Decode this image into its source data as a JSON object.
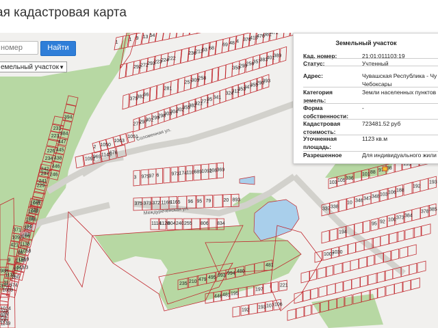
{
  "header": {
    "title": "ая кадастровая карта"
  },
  "search": {
    "placeholder": "номер",
    "button_label": "Найти"
  },
  "filter": {
    "selected": "емельный участок"
  },
  "info_panel": {
    "title": "Земельный участок",
    "rows": [
      {
        "label": "Кад. номер:",
        "value": "21:01:011103:19"
      },
      {
        "label": "Статус:",
        "value": "Учтенный"
      },
      {
        "label": "Адрес:",
        "value": "Чувашская Республика - Чу"
      },
      {
        "label": "",
        "value": "Чебоксары"
      },
      {
        "label": "Категория",
        "value": "Земли населенных пунктов"
      },
      {
        "label": "земель:",
        "value": ""
      },
      {
        "label": "Форма",
        "value": "-"
      },
      {
        "label": "собственности:",
        "value": ""
      },
      {
        "label": "Кадастровая",
        "value": "723481.52 руб"
      },
      {
        "label": "стоимость:",
        "value": ""
      },
      {
        "label": "Уточненная",
        "value": "1123 кв.м"
      },
      {
        "label": "площадь:",
        "value": ""
      },
      {
        "label": "Разрешенное",
        "value": "Для индивидуального жили"
      }
    ]
  },
  "map": {
    "colors": {
      "parcel": "#c1272d",
      "forest": "#b7d8a3",
      "water": "#a9cfeb",
      "background": "#f1f0ee",
      "building": "#bdbdbd"
    },
    "streets": [
      "Соломенная ул.",
      "Междуреченская ул."
    ],
    "labels": [
      "1",
      "1",
      "9",
      "13",
      "54",
      "122",
      "55",
      "101",
      "278",
      "319",
      "307",
      "318",
      "279",
      "265",
      "296",
      "300",
      "289",
      "275",
      "292",
      "272",
      "293",
      "223",
      "224",
      "222",
      "236",
      "213",
      "63",
      "68",
      "69",
      "48",
      "4",
      "376",
      "415",
      "476",
      "381",
      "472",
      "370",
      "373",
      "364",
      "375",
      "382",
      "66",
      "281",
      "257",
      "305",
      "258",
      "350",
      "295",
      "256",
      "357",
      "383",
      "401",
      "389",
      "277",
      "297",
      "301",
      "299",
      "298",
      "303",
      "304",
      "302",
      "355",
      "382",
      "321",
      "271",
      "95",
      "341",
      "324",
      "312",
      "353",
      "347",
      "355",
      "290",
      "393",
      "394",
      "384",
      "447",
      "445",
      "438",
      "446",
      "246",
      "231",
      "223",
      "226",
      "234",
      "237",
      "241",
      "242",
      "229",
      "230",
      "232",
      "89",
      "94",
      "83",
      "1058",
      "1059",
      "443/3",
      "1061",
      "1062",
      "1086",
      "322",
      "166",
      "1136",
      "86",
      "1146",
      "675",
      "160",
      "674",
      "371",
      "1097",
      "421",
      "9",
      "1131",
      "11",
      "1089",
      "1065",
      "1008",
      "988",
      "370",
      "1014",
      "962",
      "1149",
      "1091",
      "969",
      "1145",
      "676",
      "2",
      "1050",
      "1063",
      "1051",
      "3",
      "975",
      "97",
      "6",
      "973",
      "174",
      "110",
      "689",
      "1092",
      "108",
      "369",
      "375",
      "373",
      "372",
      "1166",
      "1165",
      "96",
      "95",
      "79",
      "20",
      "893",
      "1114",
      "1128",
      "804",
      "240",
      "255",
      "806",
      "834",
      "235",
      "210",
      "479",
      "495",
      "993",
      "994",
      "480",
      "481",
      "446",
      "481",
      "195",
      "197",
      "221",
      "192",
      "193",
      "107",
      "106",
      "103",
      "105",
      "336",
      "101",
      "88",
      "97",
      "98",
      "199",
      "102",
      "104",
      "337",
      "338",
      "10",
      "346",
      "347",
      "348",
      "103",
      "106",
      "188",
      "192",
      "193",
      "194",
      "95",
      "92",
      "100",
      "373",
      "384",
      "378",
      "385",
      "1007",
      "1030"
    ]
  }
}
